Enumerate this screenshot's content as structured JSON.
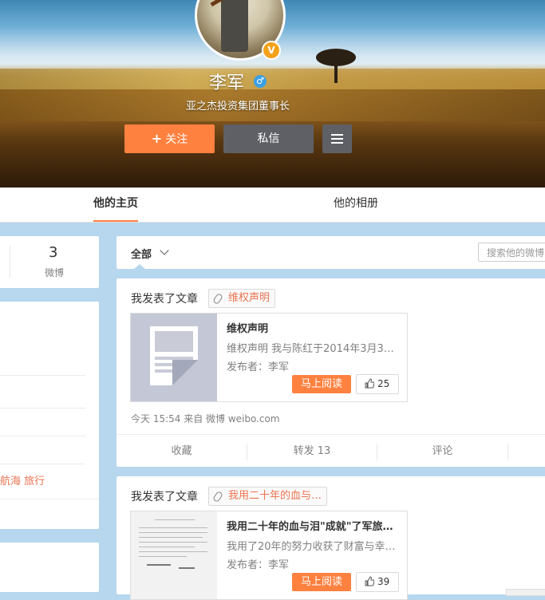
{
  "profile": {
    "name": "李军",
    "bio": "亚之杰投资集团董事长",
    "verified_badge": "V",
    "gender_icon": "male-icon",
    "follow_label": "关注",
    "message_label": "私信"
  },
  "tabs": {
    "home": "他的主页",
    "album": "他的相册"
  },
  "stats": {
    "weibo_count": "3",
    "weibo_label": "微博"
  },
  "left": {
    "tags": "航海 旅行"
  },
  "feed": {
    "filter_label": "全部",
    "search_placeholder": "搜索他的微博"
  },
  "posts": [
    {
      "title": "我发表了文章",
      "tag": "维权声明",
      "article_title": "维权声明",
      "article_desc": "维权声明 我与陈红于2014年3月3日…",
      "article_author": "发布者：李军",
      "read_label": "马上阅读",
      "likes": "25",
      "meta": "今天 15:54 来自 微博 weibo.com",
      "actions": {
        "favorite": "收藏",
        "repost": "转发 13",
        "comment": "评论"
      }
    },
    {
      "title": "我发表了文章",
      "tag": "我用二十年的血与…",
      "article_title": "我用二十年的血与泪\"成就\"了军旅…",
      "article_desc": "我用了20年的努力收获了财富与幸…",
      "article_author": "发布者：李军",
      "read_label": "马上阅读",
      "likes": "39"
    }
  ],
  "colors": {
    "accent": "#ff8140",
    "link": "#eb7350",
    "bg": "#b6d7ee",
    "dark_button": "#5f6066"
  }
}
